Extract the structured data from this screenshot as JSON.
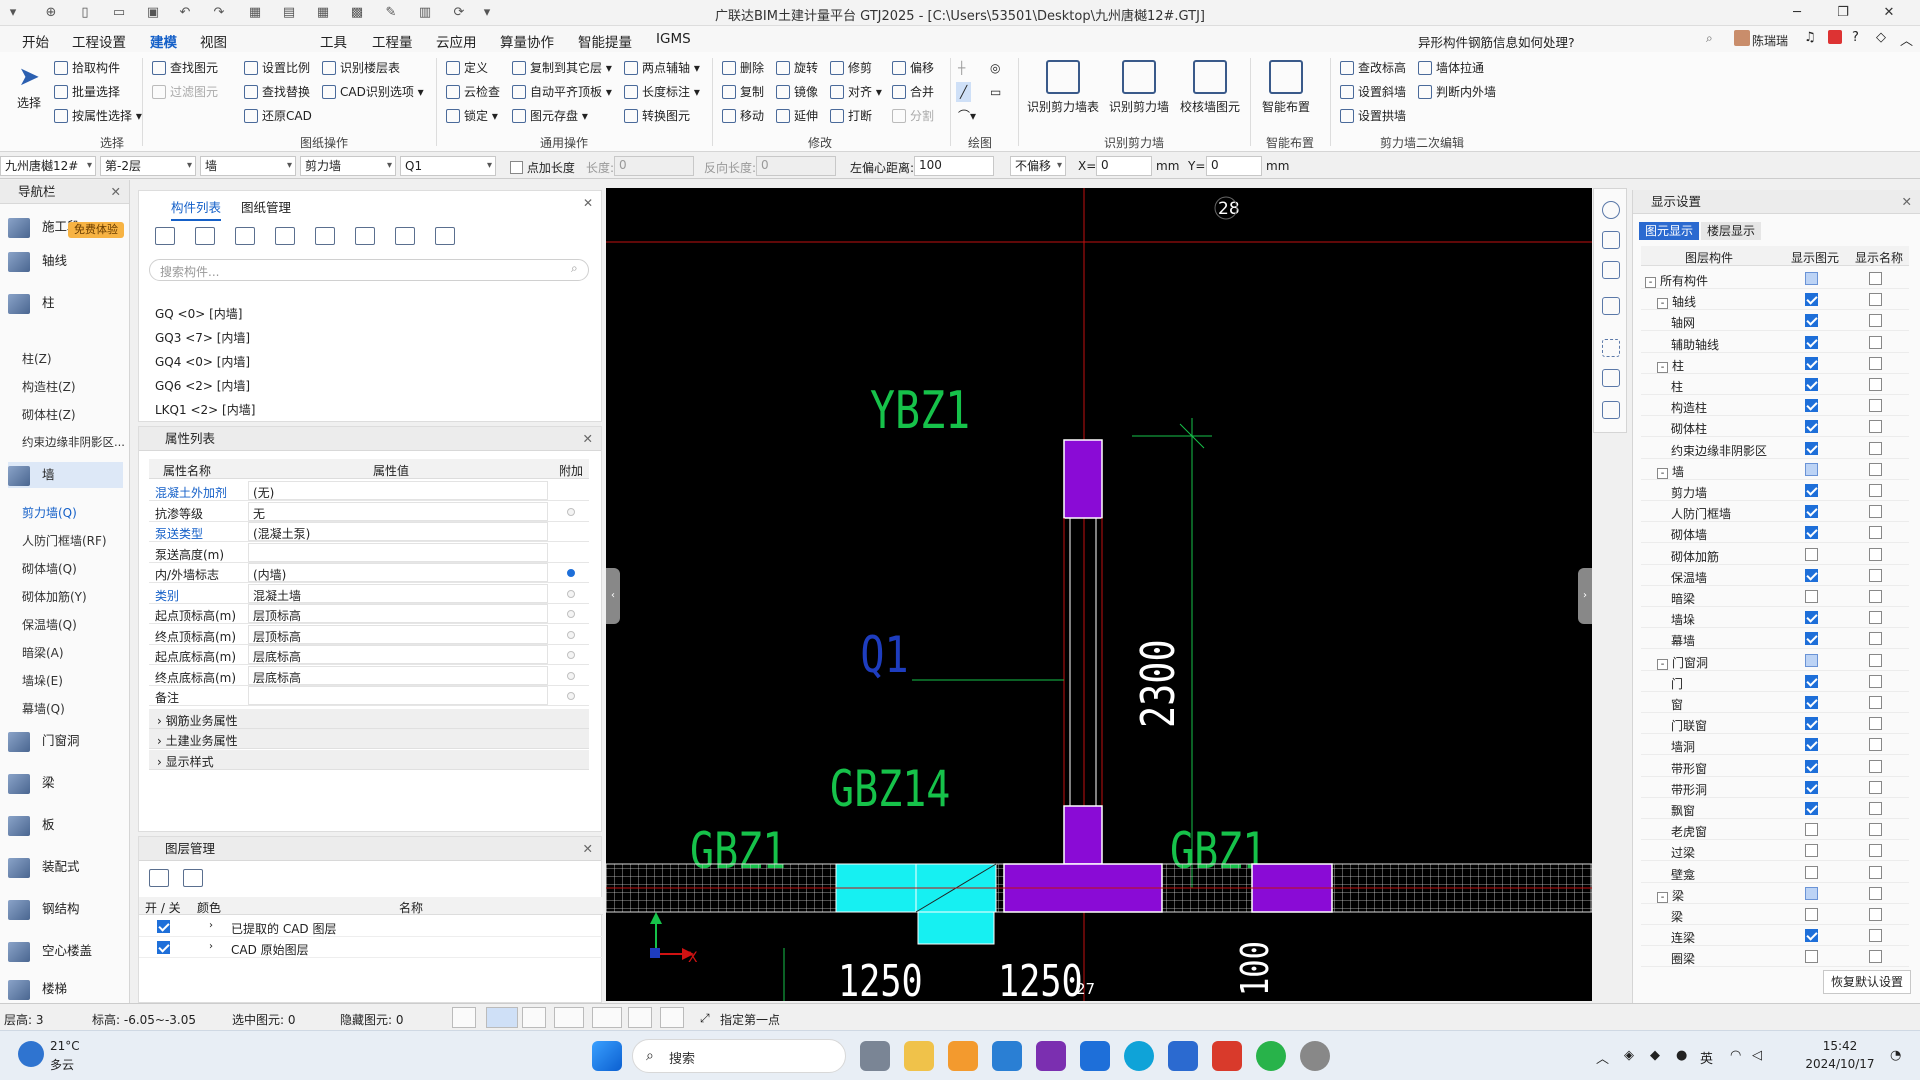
{
  "title_bar": {
    "title": "广联达BIM土建计量平台 GTJ2025 - [C:\\Users\\53501\\Desktop\\九州唐樾12#.GTJ]"
  },
  "menu": {
    "items": [
      "开始",
      "工程设置",
      "建模",
      "视图",
      "工具",
      "工程量",
      "云应用",
      "算量协作",
      "智能提量",
      "IGMS"
    ],
    "active": "建模",
    "help_search": "异形构件钢筋信息如何处理?",
    "user": "陈瑞瑞"
  },
  "ribbon": {
    "select": {
      "label": "选择",
      "items": [
        "拾取构件",
        "批量选择",
        "按属性选择"
      ],
      "group": "选择"
    },
    "drawing_ops": {
      "items": [
        "查找图元",
        "过滤图元",
        "设置比例",
        "查找替换",
        "还原CAD",
        "识别楼层表",
        "CAD识别选项"
      ],
      "group": "图纸操作"
    },
    "common_ops": {
      "items": [
        "定义",
        "云检查",
        "锁定",
        "复制到其它层",
        "自动平齐顶板",
        "图元存盘",
        "两点辅轴",
        "长度标注",
        "转换图元"
      ],
      "group": "通用操作"
    },
    "modify": {
      "items": [
        "删除",
        "旋转",
        "修剪",
        "偏移",
        "复制",
        "镜像",
        "对齐",
        "合并",
        "移动",
        "延伸",
        "打断",
        "分割"
      ],
      "group": "修改"
    },
    "draw": {
      "group": "绘图"
    },
    "recognize_wall": {
      "items": [
        "识别剪力墙表",
        "识别剪力墙",
        "校核墙图元"
      ],
      "group": "识别剪力墙"
    },
    "smart": {
      "items": [
        "智能布置"
      ],
      "group": "智能布置"
    },
    "wall_edit": {
      "items": [
        "查改标高",
        "墙体拉通",
        "设置斜墙",
        "判断内外墙",
        "设置拱墙"
      ],
      "group": "剪力墙二次编辑"
    }
  },
  "toolbar2": {
    "project": "九州唐樾12#",
    "floor": "第-2层",
    "category": "墙",
    "type": "剪力墙",
    "component": "Q1",
    "point_length_label": "点加长度",
    "length_label": "长度:",
    "length_value": "0",
    "reverse_length_label": "反向长度:",
    "reverse_length_value": "0",
    "offset_label": "左偏心距离:",
    "offset_value": "100",
    "no_offset": "不偏移",
    "x_label": "X=",
    "x_value": "0",
    "mm": "mm",
    "y_label": "Y=",
    "y_value": "0"
  },
  "nav": {
    "title": "导航栏",
    "badge": "免费体验",
    "cats": [
      {
        "label": "施工段",
        "name": "construction-section"
      },
      {
        "label": "轴线",
        "name": "axis"
      },
      {
        "label": "柱",
        "name": "column"
      },
      {
        "label": "墙",
        "name": "wall"
      },
      {
        "label": "门窗洞",
        "name": "door-window"
      },
      {
        "label": "梁",
        "name": "beam"
      },
      {
        "label": "板",
        "name": "slab"
      },
      {
        "label": "装配式",
        "name": "prefab"
      },
      {
        "label": "钢结构",
        "name": "steel"
      },
      {
        "label": "空心楼盖",
        "name": "hollow-floor"
      },
      {
        "label": "楼梯",
        "name": "stair"
      }
    ],
    "column_subs": [
      "柱(Z)",
      "构造柱(Z)",
      "砌体柱(Z)",
      "约束边缘非阴影区..."
    ],
    "wall_subs": [
      "剪力墙(Q)",
      "人防门框墙(RF)",
      "砌体墙(Q)",
      "砌体加筋(Y)",
      "保温墙(Q)",
      "暗梁(A)",
      "墙垛(E)",
      "幕墙(Q)"
    ]
  },
  "component_panel": {
    "tabs": [
      "构件列表",
      "图纸管理"
    ],
    "search_placeholder": "搜索构件...",
    "items": [
      "GQ <0> [内墙]",
      "GQ3 <7> [内墙]",
      "GQ4 <0> [内墙]",
      "GQ6 <2> [内墙]",
      "LKQ1 <2> [内墙]"
    ]
  },
  "property_panel": {
    "title": "属性列表",
    "headers": [
      "属性名称",
      "属性值",
      "附加"
    ],
    "rows": [
      {
        "name": "混凝土外加剂",
        "value": "(无)",
        "blue": true,
        "dot": "none"
      },
      {
        "name": "抗渗等级",
        "value": "无",
        "blue": false,
        "dot": "off"
      },
      {
        "name": "泵送类型",
        "value": "(混凝土泵)",
        "blue": true,
        "dot": "none"
      },
      {
        "name": "泵送高度(m)",
        "value": "",
        "blue": false,
        "dot": "none"
      },
      {
        "name": "内/外墙标志",
        "value": "(内墙)",
        "blue": false,
        "dot": "on"
      },
      {
        "name": "类别",
        "value": "混凝土墙",
        "blue": true,
        "dot": "off"
      },
      {
        "name": "起点顶标高(m)",
        "value": "层顶标高",
        "blue": false,
        "dot": "off"
      },
      {
        "name": "终点顶标高(m)",
        "value": "层顶标高",
        "blue": false,
        "dot": "off"
      },
      {
        "name": "起点底标高(m)",
        "value": "层底标高",
        "blue": false,
        "dot": "off"
      },
      {
        "name": "终点底标高(m)",
        "value": "层底标高",
        "blue": false,
        "dot": "off"
      },
      {
        "name": "备注",
        "value": "",
        "blue": false,
        "dot": "off"
      }
    ],
    "groups": [
      "钢筋业务属性",
      "土建业务属性",
      "显示样式"
    ]
  },
  "layer_panel": {
    "title": "图层管理",
    "headers": [
      "开 / 关",
      "颜色",
      "名称"
    ],
    "rows": [
      {
        "name": "已提取的 CAD 图层"
      },
      {
        "name": "CAD 原始图层"
      }
    ]
  },
  "canvas": {
    "labels": {
      "ybz1": "YBZ1",
      "q1": "Q1",
      "gbz14": "GBZ14",
      "gbz1_left": "GBZ1",
      "gbz1_right": "GBZ1",
      "dim_2300": "2300",
      "dim_1250": "1250",
      "dim_1250b": "1250",
      "dim_100": "100",
      "axis_28": "28",
      "axis_27": "27",
      "axis_x": "X"
    },
    "colors": {
      "purple": "#8a0bd6",
      "cyan": "#16f0f2",
      "green": "#16c24a",
      "red": "#d01212"
    }
  },
  "display_panel": {
    "title": "显示设置",
    "tabs": [
      "图元显示",
      "楼层显示"
    ],
    "headers": [
      "图层构件",
      "显示图元",
      "显示名称"
    ],
    "rows": [
      {
        "label": "所有构件",
        "level": 0,
        "tog": "-",
        "c1": "part",
        "c2": "off"
      },
      {
        "label": "轴线",
        "level": 1,
        "tog": "-",
        "c1": "on",
        "c2": "off"
      },
      {
        "label": "轴网",
        "level": 2,
        "c1": "on",
        "c2": "off"
      },
      {
        "label": "辅助轴线",
        "level": 2,
        "c1": "on",
        "c2": "off"
      },
      {
        "label": "柱",
        "level": 1,
        "tog": "-",
        "c1": "on",
        "c2": "off"
      },
      {
        "label": "柱",
        "level": 2,
        "c1": "on",
        "c2": "off"
      },
      {
        "label": "构造柱",
        "level": 2,
        "c1": "on",
        "c2": "off"
      },
      {
        "label": "砌体柱",
        "level": 2,
        "c1": "on",
        "c2": "off"
      },
      {
        "label": "约束边缘非阴影区",
        "level": 2,
        "c1": "on",
        "c2": "off"
      },
      {
        "label": "墙",
        "level": 1,
        "tog": "-",
        "c1": "part",
        "c2": "off"
      },
      {
        "label": "剪力墙",
        "level": 2,
        "c1": "on",
        "c2": "off"
      },
      {
        "label": "人防门框墙",
        "level": 2,
        "c1": "on",
        "c2": "off"
      },
      {
        "label": "砌体墙",
        "level": 2,
        "c1": "on",
        "c2": "off"
      },
      {
        "label": "砌体加筋",
        "level": 2,
        "c1": "off",
        "c2": "off"
      },
      {
        "label": "保温墙",
        "level": 2,
        "c1": "on",
        "c2": "off"
      },
      {
        "label": "暗梁",
        "level": 2,
        "c1": "off",
        "c2": "off"
      },
      {
        "label": "墙垛",
        "level": 2,
        "c1": "on",
        "c2": "off"
      },
      {
        "label": "幕墙",
        "level": 2,
        "c1": "on",
        "c2": "off"
      },
      {
        "label": "门窗洞",
        "level": 1,
        "tog": "-",
        "c1": "part",
        "c2": "off"
      },
      {
        "label": "门",
        "level": 2,
        "c1": "on",
        "c2": "off"
      },
      {
        "label": "窗",
        "level": 2,
        "c1": "on",
        "c2": "off"
      },
      {
        "label": "门联窗",
        "level": 2,
        "c1": "on",
        "c2": "off"
      },
      {
        "label": "墙洞",
        "level": 2,
        "c1": "on",
        "c2": "off"
      },
      {
        "label": "带形窗",
        "level": 2,
        "c1": "on",
        "c2": "off"
      },
      {
        "label": "带形洞",
        "level": 2,
        "c1": "on",
        "c2": "off"
      },
      {
        "label": "飘窗",
        "level": 2,
        "c1": "on",
        "c2": "off"
      },
      {
        "label": "老虎窗",
        "level": 2,
        "c1": "off",
        "c2": "off"
      },
      {
        "label": "过梁",
        "level": 2,
        "c1": "off",
        "c2": "off"
      },
      {
        "label": "壁龛",
        "level": 2,
        "c1": "off",
        "c2": "off"
      },
      {
        "label": "梁",
        "level": 1,
        "tog": "-",
        "c1": "part",
        "c2": "off"
      },
      {
        "label": "梁",
        "level": 2,
        "c1": "off",
        "c2": "off"
      },
      {
        "label": "连梁",
        "level": 2,
        "c1": "on",
        "c2": "off"
      },
      {
        "label": "圈梁",
        "level": 2,
        "c1": "off",
        "c2": "off"
      }
    ],
    "restore": "恢复默认设置"
  },
  "status_bar": {
    "floor_height": "层高:  3",
    "elevation": "标高:  -6.05~-3.05",
    "selected": "选中图元:  0",
    "hidden": "隐藏图元:  0",
    "hint": "指定第一点"
  },
  "taskbar": {
    "weather_temp": "21°C",
    "weather_desc": "多云",
    "search": "搜索",
    "ime": "英",
    "time": "15:42",
    "date": "2024/10/17"
  }
}
